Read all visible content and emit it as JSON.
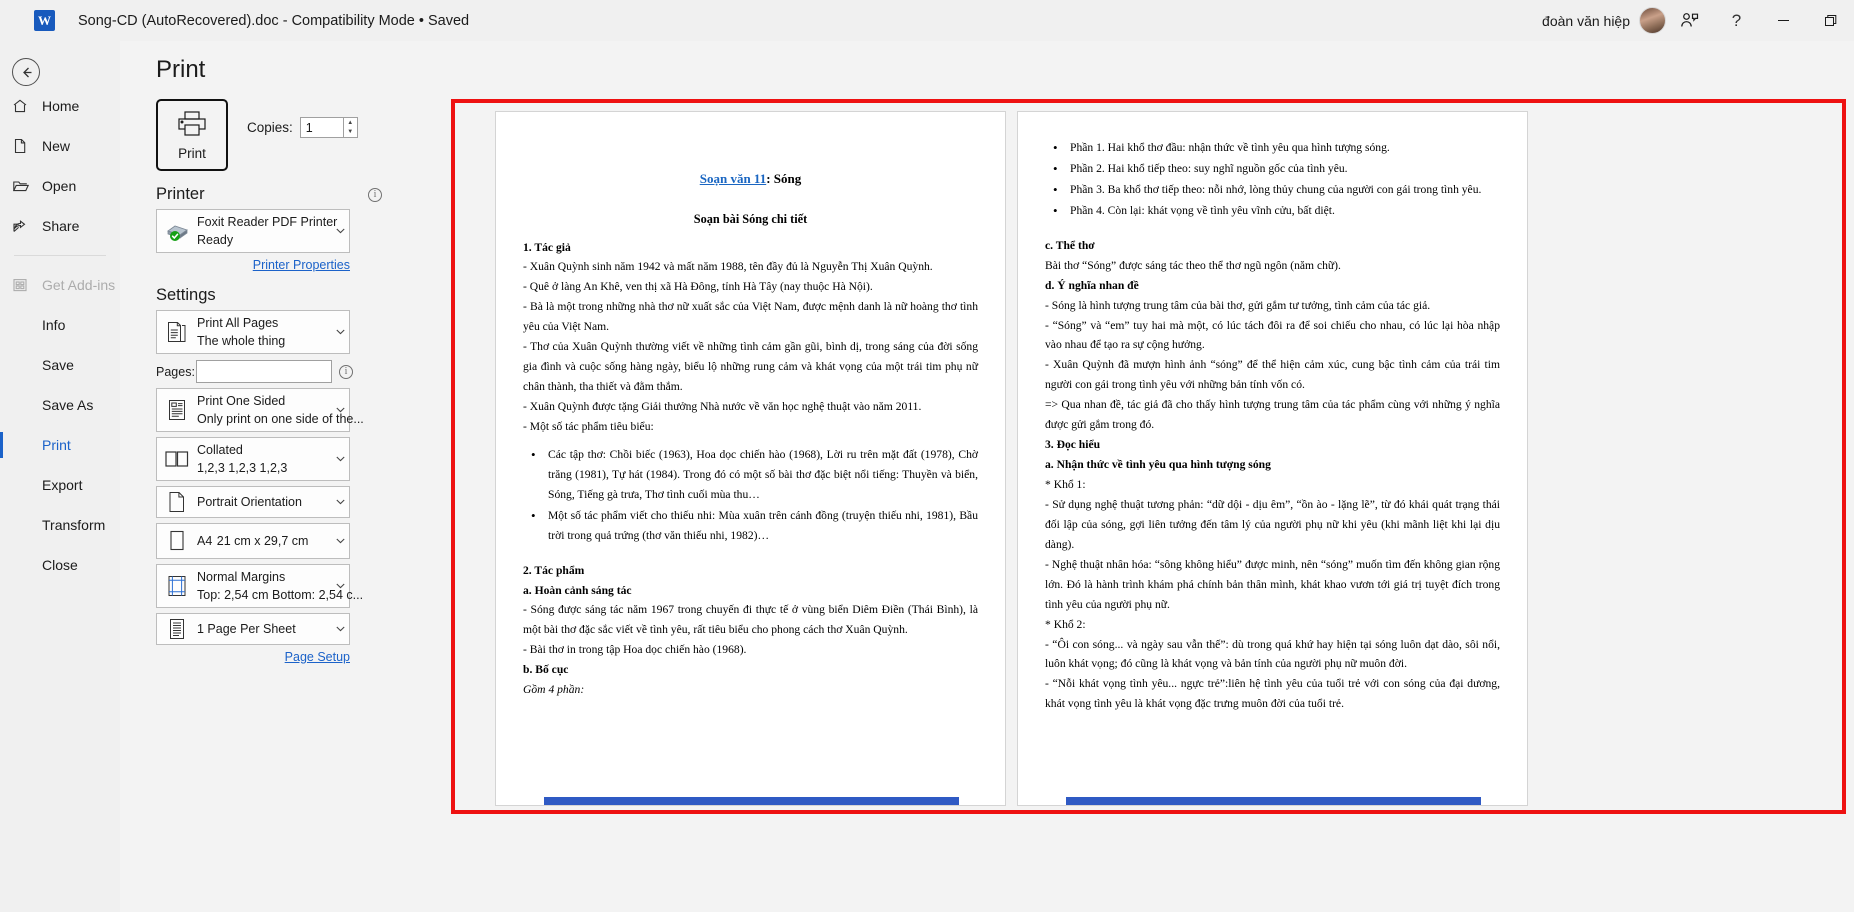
{
  "titlebar": {
    "app_icon": "word-logo",
    "title": "Song-CD (AutoRecovered).doc  -  Compatibility Mode • Saved",
    "user_name": "đoàn văn hiệp",
    "share_icon": "person-share-icon",
    "help_icon": "question-mark-icon",
    "minimize_icon": "minimize-icon",
    "restore_icon": "restore-icon",
    "help_label": "?"
  },
  "sidebar": {
    "back_icon": "back-arrow-icon",
    "items": [
      {
        "label": "Home",
        "icon": "home-icon",
        "state": "normal"
      },
      {
        "label": "New",
        "icon": "new-document-icon",
        "state": "normal"
      },
      {
        "label": "Open",
        "icon": "open-folder-icon",
        "state": "normal"
      },
      {
        "label": "Share",
        "icon": "share-icon",
        "state": "normal"
      },
      {
        "label": "Get Add-ins",
        "icon": "addins-grid-icon",
        "state": "disabled"
      },
      {
        "label": "Info",
        "icon": "",
        "state": "normal"
      },
      {
        "label": "Save",
        "icon": "",
        "state": "normal"
      },
      {
        "label": "Save As",
        "icon": "",
        "state": "normal"
      },
      {
        "label": "Print",
        "icon": "",
        "state": "active"
      },
      {
        "label": "Export",
        "icon": "",
        "state": "normal"
      },
      {
        "label": "Transform",
        "icon": "",
        "state": "normal"
      },
      {
        "label": "Close",
        "icon": "",
        "state": "normal"
      }
    ]
  },
  "print_pane": {
    "title": "Print",
    "print_button_label": "Print",
    "print_button_icon": "printer-icon",
    "copies_label": "Copies:",
    "copies_value": "1",
    "printer_section": "Printer",
    "printer_info_icon": "info-icon",
    "printer_name": "Foxit Reader PDF Printer",
    "printer_status": "Ready",
    "printer_icon": "printer-device-icon",
    "printer_properties_link": "Printer Properties",
    "settings_section": "Settings",
    "pages_label": "Pages:",
    "pages_value": "",
    "pages_info_icon": "info-icon",
    "page_setup_link": "Page Setup",
    "settings": [
      {
        "icon": "print-all-pages-icon",
        "line1": "Print All Pages",
        "line2": "The whole thing"
      },
      {
        "icon": "one-sided-icon",
        "line1": "Print One Sided",
        "line2": "Only print on one side of the..."
      },
      {
        "icon": "collated-icon",
        "line1": "Collated",
        "line2": "1,2,3   1,2,3   1,2,3"
      },
      {
        "icon": "portrait-icon",
        "line1": "Portrait Orientation",
        "line2": ""
      },
      {
        "icon": "paper-size-icon",
        "line1": "A4",
        "line2": "21 cm x 29,7 cm"
      },
      {
        "icon": "margins-icon",
        "line1": "Normal Margins",
        "line2": "Top: 2,54 cm Bottom: 2,54 c..."
      },
      {
        "icon": "pages-per-sheet-icon",
        "line1": "1 Page Per Sheet",
        "line2": ""
      }
    ]
  },
  "preview": {
    "highlight_color": "#ee1111",
    "left_page": {
      "title_link": "Soạn văn 11",
      "title_rest": ": Sóng",
      "subtitle": "Soạn bài Sóng chi tiết",
      "h1": "1. Tác giả",
      "paras": [
        "- Xuân Quỳnh sinh năm 1942 và mất năm 1988, tên đầy đủ là Nguyễn Thị Xuân Quỳnh.",
        "- Quê ở làng An Khê, ven thị xã Hà Đông, tỉnh Hà Tây (nay thuộc Hà Nội).",
        "- Bà là một trong những nhà thơ nữ xuất sắc của Việt Nam, được mệnh danh là nữ hoàng thơ tình yêu của Việt Nam.",
        "- Thơ của Xuân Quỳnh thường viết về những tình cảm gần gũi, bình dị, trong sáng của đời sống gia đình và cuộc sống hàng ngày, biểu lộ những rung cảm và khát vọng của một trái tim phụ nữ chân thành, tha thiết và đằm thắm.",
        "- Xuân Quỳnh được tặng Giải thưởng Nhà nước về văn học nghệ thuật vào năm 2011.",
        "- Một số tác phẩm tiêu biểu:"
      ],
      "bullets": [
        "Các tập thơ: Chồi biếc (1963), Hoa dọc chiến hào (1968), Lời ru trên mặt đất (1978), Chờ trăng (1981), Tự hát (1984). Trong đó có một số bài thơ đặc biệt nổi tiếng: Thuyền và biển, Sóng, Tiếng gà trưa, Thơ tình cuối mùa thu…",
        "Một số tác phẩm viết cho thiếu nhi: Mùa xuân trên cánh đồng (truyện thiếu nhi, 1981), Bầu trời trong quả trứng (thơ văn thiếu nhi, 1982)…"
      ],
      "h2": "2. Tác phẩm",
      "h2a": "a. Hoàn cảnh sáng tác",
      "paras2": [
        "- Sóng được sáng tác năm 1967 trong chuyến đi thực tế ở vùng biển Diêm Điền (Thái Bình), là một bài thơ đặc sắc viết về tình yêu, rất tiêu biểu cho phong cách thơ Xuân Quỳnh.",
        "- Bài thơ in trong tập Hoa dọc chiến hào (1968)."
      ],
      "h2b": "b. Bố cục",
      "bocuc": "Gồm 4 phần:"
    },
    "right_page": {
      "bullets": [
        "Phần 1. Hai khổ thơ đầu: nhận thức về tình yêu qua hình tượng sóng.",
        "Phần 2. Hai khổ tiếp theo: suy nghĩ nguồn gốc của tình yêu.",
        "Phần 3. Ba khổ thơ tiếp theo: nỗi nhớ, lòng thủy chung của người con gái trong tình yêu.",
        "Phần 4. Còn lại: khát vọng về tình yêu vĩnh cửu, bất diệt."
      ],
      "hc": "c. Thể thơ",
      "pc": "Bài thơ “Sóng” được sáng tác theo thể thơ ngũ ngôn (năm chữ).",
      "hd": "d. Ý nghĩa nhan đề",
      "pd": [
        "- Sóng là hình tượng trung tâm của bài thơ, gửi gắm tư tưởng, tình cảm của tác giả.",
        "- “Sóng” và “em” tuy hai mà một, có lúc tách đôi ra để soi chiếu cho nhau, có lúc lại hòa nhập vào nhau để tạo ra sự cộng hưởng.",
        "- Xuân Quỳnh đã mượn hình ảnh “sóng” để thể hiện cảm xúc, cung bậc tình cảm của trái tim người con gái trong tình yêu với những bản tính vốn có.",
        "=> Qua nhan đề, tác giả đã cho thấy hình tượng trung tâm của tác phẩm cùng với những ý nghĩa được gửi gắm trong đó."
      ],
      "h3": "3. Đọc hiểu",
      "h3a": "a. Nhận thức về tình yêu qua hình tượng sóng",
      "kho1": "* Khổ 1:",
      "p1": [
        "- Sử dụng nghệ thuật tương phản: “dữ dội - dịu êm”, “ồn ào - lặng lẽ”, từ đó khái quát trạng thái đối lập của sóng, gợi liên tưởng đến tâm lý của người phụ nữ khi yêu (khi mãnh liệt khi lại dịu dàng).",
        "- Nghệ thuật nhân hóa: “sông không hiểu” được minh, nên “sóng” muốn tìm đến không gian rộng lớn. Đó là hành trình khám phá chính bản thân mình, khát khao vươn tới giá trị tuyệt đích trong tình yêu của người phụ nữ."
      ],
      "kho2": "* Khổ 2:",
      "p2": [
        "- “Ôi con sóng... và ngày sau vẫn thế”: dù trong quá khứ hay hiện tại sóng luôn dạt dào, sôi nổi, luôn khát vọng; đó cũng là khát vọng và bản tính của người phụ nữ muôn đời.",
        "- “Nỗi khát vọng tình yêu... ngực trẻ”:liên hệ tình yêu của tuổi trẻ với con sóng của đại dương, khát vọng tình yêu là khát vọng đặc trưng muôn đời của tuổi trẻ."
      ]
    }
  }
}
